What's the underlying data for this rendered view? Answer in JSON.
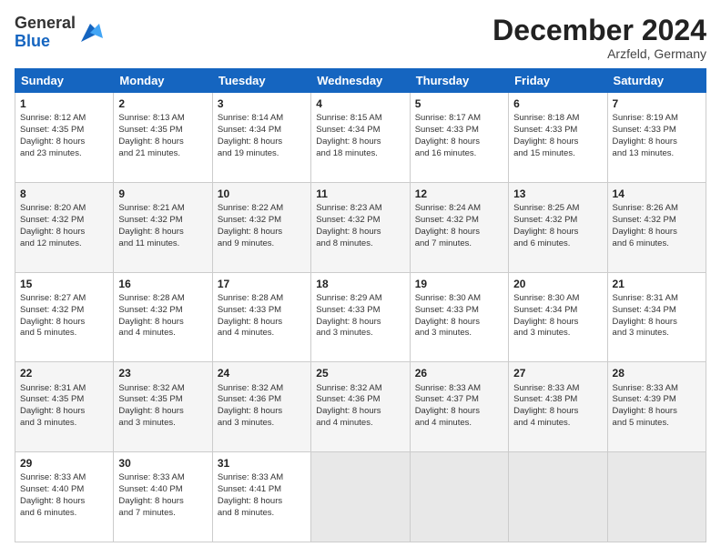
{
  "header": {
    "logo_general": "General",
    "logo_blue": "Blue",
    "month_title": "December 2024",
    "location": "Arzfeld, Germany"
  },
  "days_of_week": [
    "Sunday",
    "Monday",
    "Tuesday",
    "Wednesday",
    "Thursday",
    "Friday",
    "Saturday"
  ],
  "weeks": [
    [
      {
        "day": 1,
        "lines": [
          "Sunrise: 8:12 AM",
          "Sunset: 4:35 PM",
          "Daylight: 8 hours",
          "and 23 minutes."
        ]
      },
      {
        "day": 2,
        "lines": [
          "Sunrise: 8:13 AM",
          "Sunset: 4:35 PM",
          "Daylight: 8 hours",
          "and 21 minutes."
        ]
      },
      {
        "day": 3,
        "lines": [
          "Sunrise: 8:14 AM",
          "Sunset: 4:34 PM",
          "Daylight: 8 hours",
          "and 19 minutes."
        ]
      },
      {
        "day": 4,
        "lines": [
          "Sunrise: 8:15 AM",
          "Sunset: 4:34 PM",
          "Daylight: 8 hours",
          "and 18 minutes."
        ]
      },
      {
        "day": 5,
        "lines": [
          "Sunrise: 8:17 AM",
          "Sunset: 4:33 PM",
          "Daylight: 8 hours",
          "and 16 minutes."
        ]
      },
      {
        "day": 6,
        "lines": [
          "Sunrise: 8:18 AM",
          "Sunset: 4:33 PM",
          "Daylight: 8 hours",
          "and 15 minutes."
        ]
      },
      {
        "day": 7,
        "lines": [
          "Sunrise: 8:19 AM",
          "Sunset: 4:33 PM",
          "Daylight: 8 hours",
          "and 13 minutes."
        ]
      }
    ],
    [
      {
        "day": 8,
        "lines": [
          "Sunrise: 8:20 AM",
          "Sunset: 4:32 PM",
          "Daylight: 8 hours",
          "and 12 minutes."
        ]
      },
      {
        "day": 9,
        "lines": [
          "Sunrise: 8:21 AM",
          "Sunset: 4:32 PM",
          "Daylight: 8 hours",
          "and 11 minutes."
        ]
      },
      {
        "day": 10,
        "lines": [
          "Sunrise: 8:22 AM",
          "Sunset: 4:32 PM",
          "Daylight: 8 hours",
          "and 9 minutes."
        ]
      },
      {
        "day": 11,
        "lines": [
          "Sunrise: 8:23 AM",
          "Sunset: 4:32 PM",
          "Daylight: 8 hours",
          "and 8 minutes."
        ]
      },
      {
        "day": 12,
        "lines": [
          "Sunrise: 8:24 AM",
          "Sunset: 4:32 PM",
          "Daylight: 8 hours",
          "and 7 minutes."
        ]
      },
      {
        "day": 13,
        "lines": [
          "Sunrise: 8:25 AM",
          "Sunset: 4:32 PM",
          "Daylight: 8 hours",
          "and 6 minutes."
        ]
      },
      {
        "day": 14,
        "lines": [
          "Sunrise: 8:26 AM",
          "Sunset: 4:32 PM",
          "Daylight: 8 hours",
          "and 6 minutes."
        ]
      }
    ],
    [
      {
        "day": 15,
        "lines": [
          "Sunrise: 8:27 AM",
          "Sunset: 4:32 PM",
          "Daylight: 8 hours",
          "and 5 minutes."
        ]
      },
      {
        "day": 16,
        "lines": [
          "Sunrise: 8:28 AM",
          "Sunset: 4:32 PM",
          "Daylight: 8 hours",
          "and 4 minutes."
        ]
      },
      {
        "day": 17,
        "lines": [
          "Sunrise: 8:28 AM",
          "Sunset: 4:33 PM",
          "Daylight: 8 hours",
          "and 4 minutes."
        ]
      },
      {
        "day": 18,
        "lines": [
          "Sunrise: 8:29 AM",
          "Sunset: 4:33 PM",
          "Daylight: 8 hours",
          "and 3 minutes."
        ]
      },
      {
        "day": 19,
        "lines": [
          "Sunrise: 8:30 AM",
          "Sunset: 4:33 PM",
          "Daylight: 8 hours",
          "and 3 minutes."
        ]
      },
      {
        "day": 20,
        "lines": [
          "Sunrise: 8:30 AM",
          "Sunset: 4:34 PM",
          "Daylight: 8 hours",
          "and 3 minutes."
        ]
      },
      {
        "day": 21,
        "lines": [
          "Sunrise: 8:31 AM",
          "Sunset: 4:34 PM",
          "Daylight: 8 hours",
          "and 3 minutes."
        ]
      }
    ],
    [
      {
        "day": 22,
        "lines": [
          "Sunrise: 8:31 AM",
          "Sunset: 4:35 PM",
          "Daylight: 8 hours",
          "and 3 minutes."
        ]
      },
      {
        "day": 23,
        "lines": [
          "Sunrise: 8:32 AM",
          "Sunset: 4:35 PM",
          "Daylight: 8 hours",
          "and 3 minutes."
        ]
      },
      {
        "day": 24,
        "lines": [
          "Sunrise: 8:32 AM",
          "Sunset: 4:36 PM",
          "Daylight: 8 hours",
          "and 3 minutes."
        ]
      },
      {
        "day": 25,
        "lines": [
          "Sunrise: 8:32 AM",
          "Sunset: 4:36 PM",
          "Daylight: 8 hours",
          "and 4 minutes."
        ]
      },
      {
        "day": 26,
        "lines": [
          "Sunrise: 8:33 AM",
          "Sunset: 4:37 PM",
          "Daylight: 8 hours",
          "and 4 minutes."
        ]
      },
      {
        "day": 27,
        "lines": [
          "Sunrise: 8:33 AM",
          "Sunset: 4:38 PM",
          "Daylight: 8 hours",
          "and 4 minutes."
        ]
      },
      {
        "day": 28,
        "lines": [
          "Sunrise: 8:33 AM",
          "Sunset: 4:39 PM",
          "Daylight: 8 hours",
          "and 5 minutes."
        ]
      }
    ],
    [
      {
        "day": 29,
        "lines": [
          "Sunrise: 8:33 AM",
          "Sunset: 4:40 PM",
          "Daylight: 8 hours",
          "and 6 minutes."
        ]
      },
      {
        "day": 30,
        "lines": [
          "Sunrise: 8:33 AM",
          "Sunset: 4:40 PM",
          "Daylight: 8 hours",
          "and 7 minutes."
        ]
      },
      {
        "day": 31,
        "lines": [
          "Sunrise: 8:33 AM",
          "Sunset: 4:41 PM",
          "Daylight: 8 hours",
          "and 8 minutes."
        ]
      },
      null,
      null,
      null,
      null
    ]
  ]
}
